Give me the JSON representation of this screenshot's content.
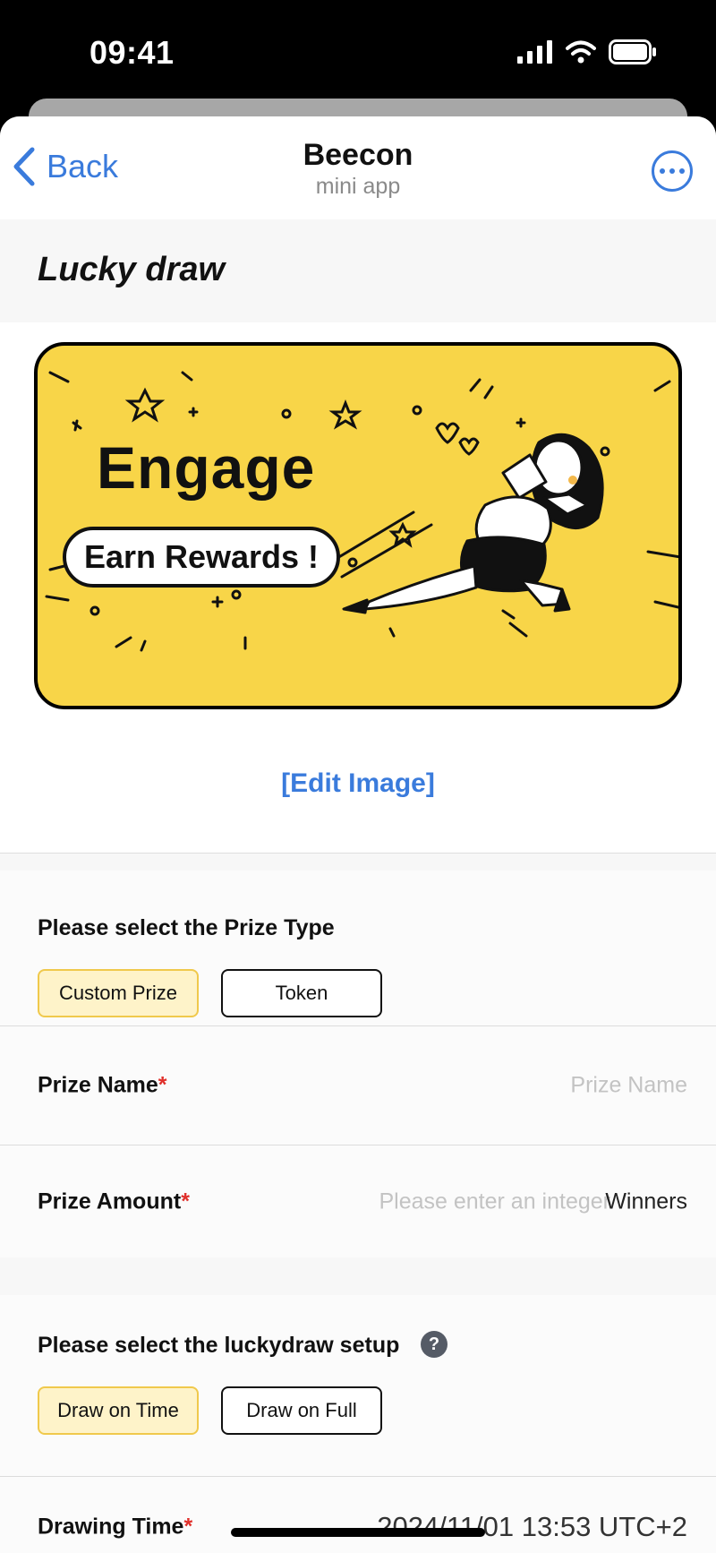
{
  "status_bar": {
    "time": "09:41"
  },
  "nav": {
    "back_label": "Back",
    "title": "Beecon",
    "subtitle": "mini app"
  },
  "page": {
    "title": "Lucky draw"
  },
  "banner": {
    "headline": "Engage",
    "pill_text": "Earn Rewards !",
    "accent_color": "#f8d548"
  },
  "edit_image_label": "[Edit Image]",
  "prize_type": {
    "label": "Please select the Prize Type",
    "options": [
      "Custom Prize",
      "Token"
    ],
    "selected": "Custom Prize"
  },
  "prize_name": {
    "label": "Prize Name",
    "required_mark": "*",
    "placeholder": "Prize Name",
    "value": ""
  },
  "prize_amount": {
    "label": "Prize Amount",
    "required_mark": "*",
    "placeholder": "Please enter an integer",
    "suffix": "Winners",
    "value": ""
  },
  "draw_setup": {
    "label": "Please select the luckydraw setup",
    "help_icon": "?",
    "options": [
      "Draw on Time",
      "Draw on Full"
    ],
    "selected": "Draw on Time"
  },
  "drawing_time": {
    "label": "Drawing Time",
    "required_mark": "*",
    "value": "2024/11/01 13:53 UTC+2"
  },
  "colors": {
    "link": "#3a7bdc",
    "selected_chip_bg": "#fef3c9",
    "selected_chip_border": "#f0c94c",
    "required": "#e0302b"
  }
}
